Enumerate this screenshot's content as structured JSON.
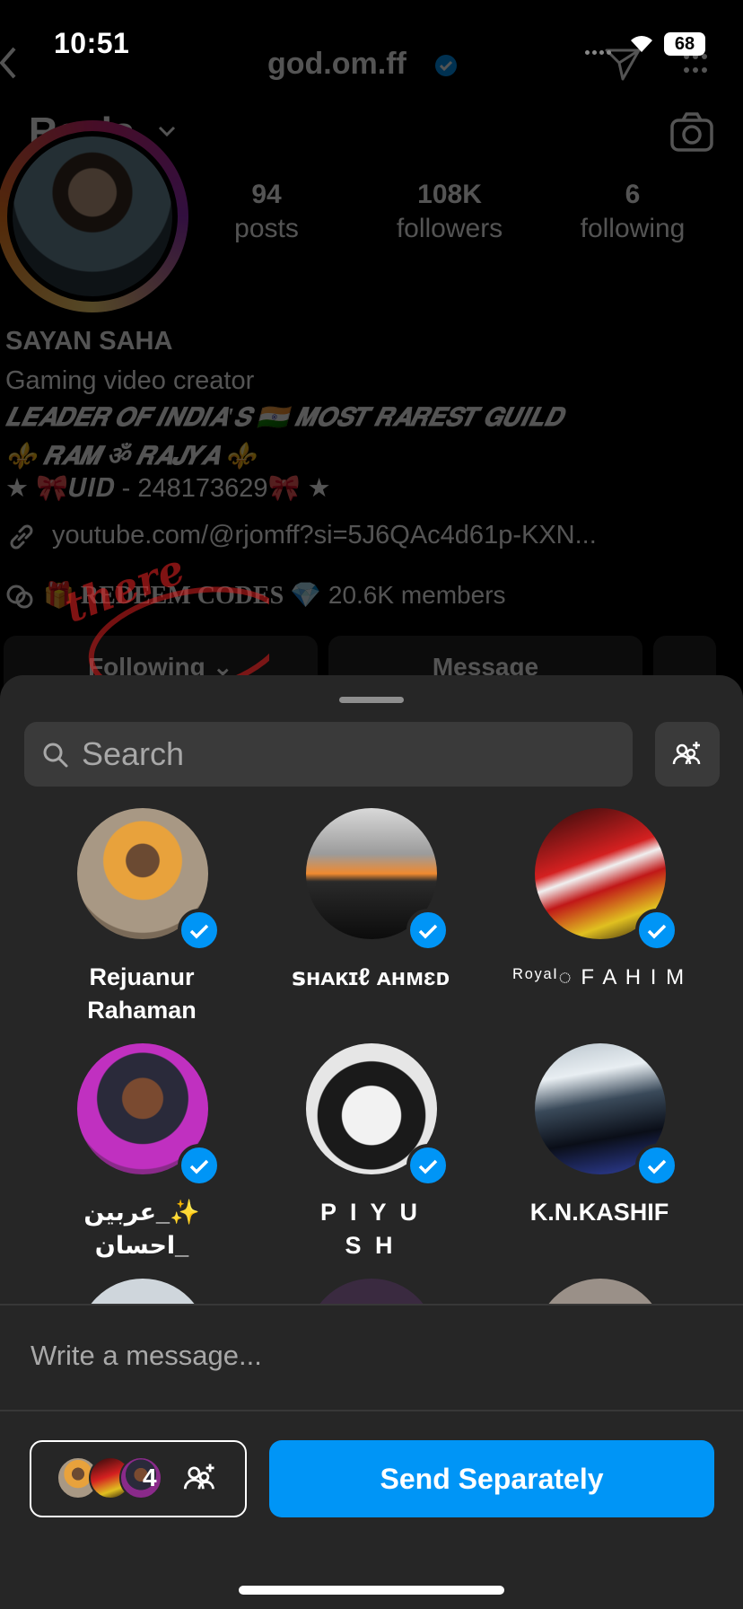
{
  "status_bar": {
    "time": "10:51",
    "battery": "68"
  },
  "profile": {
    "username": "god.om.ff",
    "reels_label": "Reels",
    "stats": [
      {
        "value": "94",
        "label": "posts"
      },
      {
        "value": "108K",
        "label": "followers"
      },
      {
        "value": "6",
        "label": "following"
      }
    ],
    "name": "SAYAN SAHA",
    "bio_line1": "Gaming video creator",
    "bio_line2": "𝑳𝑬𝑨𝑫𝑬𝑹 𝑶𝑭 𝑰𝑵𝑫𝑰𝑨'𝑺 🇮🇳 𝑴𝑶𝑺𝑻 𝑹𝑨𝑹𝑬𝑺𝑻 𝑮𝑼𝑰𝑳𝑫",
    "bio_line3": "⚜️ 𝑹𝑨𝑴 ॐ 𝑹𝑨𝑱𝒀𝑨 ⚜️",
    "bio_line4": "★ 🎀𝑼𝑰𝑫 - 248173629🎀 ★",
    "link": "youtube.com/@rjomff?si=5J6QAc4d61p-KXN...",
    "channel_name": "🎁 REDEEM CODES 💎",
    "channel_members": "20.6K members",
    "following_button": "Following ⌄",
    "message_button": "Message",
    "annotation": "there"
  },
  "sheet": {
    "search_placeholder": "Search",
    "message_placeholder": "Write a message...",
    "contacts": [
      {
        "name": "Rejuanur\nRahaman",
        "selected": true
      },
      {
        "name": "ꜱʜᴀᴋɪℓ ᴀʜᴍɛᴅ",
        "selected": true
      },
      {
        "name": "ᴿᵒʸᵃᴵ◌ F A H I M",
        "selected": true
      },
      {
        "name": "عربين_✨\nاحسان_",
        "selected": true
      },
      {
        "name": "P I Y U\nS H",
        "selected": true
      },
      {
        "name": "K.N.KASHIF",
        "selected": true
      }
    ],
    "selected_count": "4",
    "send_button": "Send Separately"
  },
  "colors": {
    "accent": "#0095f6",
    "sheet_bg": "#262626",
    "field_bg": "#3a3a3a"
  }
}
